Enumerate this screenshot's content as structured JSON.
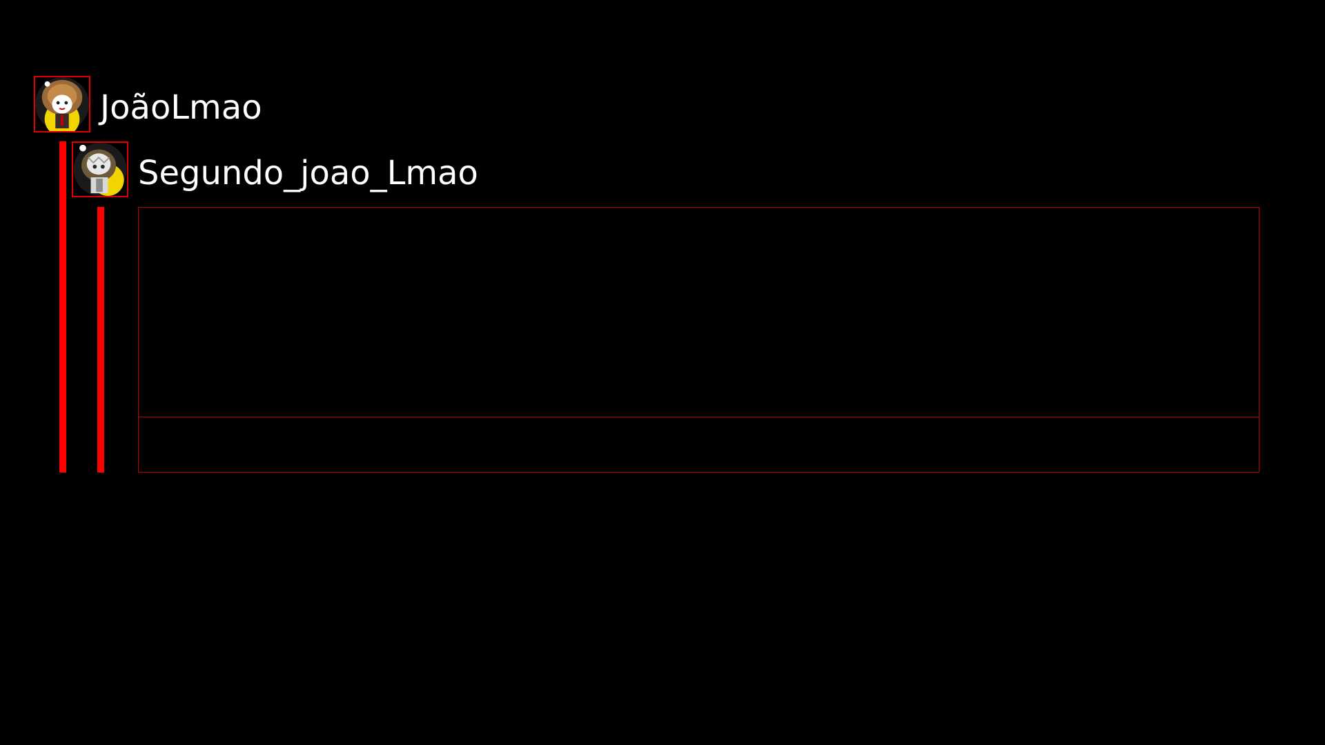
{
  "thread": {
    "comment_1": {
      "username": "JoãoLmao",
      "avatar_icon": "user-avatar-icon"
    },
    "comment_2": {
      "username": "Segundo_joao_Lmao",
      "avatar_icon": "user-avatar-icon"
    }
  },
  "colors": {
    "background": "#000000",
    "accent": "#ff0000",
    "text": "#ffffff"
  }
}
